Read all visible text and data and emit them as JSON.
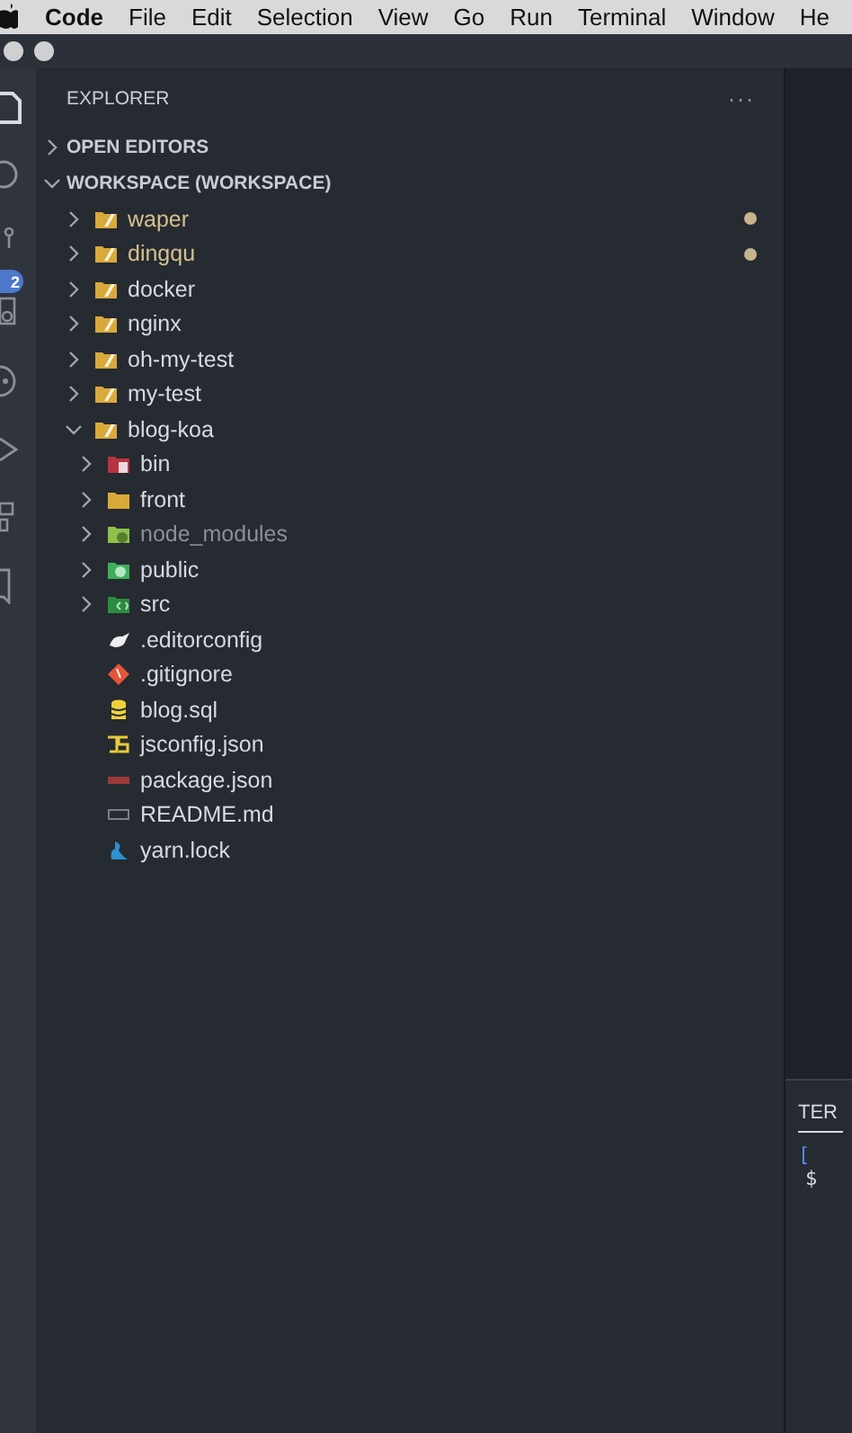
{
  "menu_bar": [
    "Code",
    "File",
    "Edit",
    "Selection",
    "View",
    "Go",
    "Run",
    "Terminal",
    "Window",
    "He"
  ],
  "activity_bar": {
    "badge": "2"
  },
  "sidebar": {
    "title": "EXPLORER",
    "more": "···",
    "sections": [
      {
        "label": "OPEN EDITORS",
        "expanded": false
      },
      {
        "label": "WORKSPACE (WORKSPACE)",
        "expanded": true
      }
    ],
    "tree": [
      {
        "label": "waper",
        "kind": "folder",
        "expanded": false,
        "modified": true,
        "dimmed": false
      },
      {
        "label": "dingqu",
        "kind": "folder",
        "expanded": false,
        "modified": true,
        "dimmed": false
      },
      {
        "label": "docker",
        "kind": "folder",
        "expanded": false,
        "modified": false,
        "dimmed": false
      },
      {
        "label": "nginx",
        "kind": "folder",
        "expanded": false,
        "modified": false,
        "dimmed": false
      },
      {
        "label": "oh-my-test",
        "kind": "folder",
        "expanded": false,
        "modified": false,
        "dimmed": false
      },
      {
        "label": "my-test",
        "kind": "folder",
        "expanded": false,
        "modified": false,
        "dimmed": false
      },
      {
        "label": "blog-koa",
        "kind": "folder",
        "expanded": true,
        "modified": false,
        "dimmed": false,
        "children": [
          {
            "label": "bin",
            "kind": "bin-folder",
            "expanded": false,
            "modified": false,
            "dimmed": false
          },
          {
            "label": "front",
            "kind": "plain-folder",
            "expanded": false,
            "modified": false,
            "dimmed": false
          },
          {
            "label": "node_modules",
            "kind": "node-folder",
            "expanded": false,
            "modified": false,
            "dimmed": true
          },
          {
            "label": "public",
            "kind": "public-folder",
            "expanded": false,
            "modified": false,
            "dimmed": false
          },
          {
            "label": "src",
            "kind": "src-folder",
            "expanded": false,
            "modified": false,
            "dimmed": false
          },
          {
            "label": ".editorconfig",
            "kind": "config",
            "modified": false,
            "dimmed": false
          },
          {
            "label": ".gitignore",
            "kind": "git",
            "modified": false,
            "dimmed": false
          },
          {
            "label": "blog.sql",
            "kind": "database",
            "modified": false,
            "dimmed": false
          },
          {
            "label": "jsconfig.json",
            "kind": "js",
            "modified": false,
            "dimmed": false
          },
          {
            "label": "package.json",
            "kind": "npm",
            "modified": false,
            "dimmed": false
          },
          {
            "label": "README.md",
            "kind": "markdown",
            "modified": false,
            "dimmed": false
          },
          {
            "label": "yarn.lock",
            "kind": "yarn",
            "modified": false,
            "dimmed": false
          }
        ]
      }
    ]
  },
  "panel": {
    "tabs": [
      {
        "label": "TER",
        "selected": true
      }
    ],
    "terminal_lines": [
      "[",
      "$"
    ]
  }
}
